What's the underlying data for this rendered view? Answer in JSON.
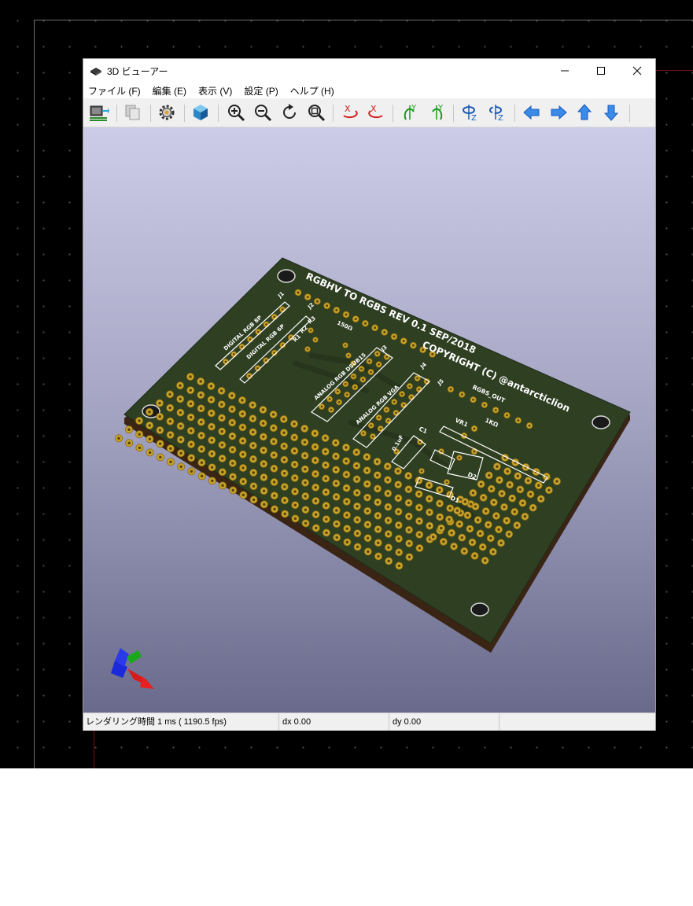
{
  "window": {
    "title": "3D ビューアー",
    "controls": {
      "minimize": "—",
      "maximize": "☐",
      "close": "✕"
    }
  },
  "menu": [
    {
      "label": "ファイル (F)"
    },
    {
      "label": "編集 (E)"
    },
    {
      "label": "表示 (V)"
    },
    {
      "label": "設定 (P)"
    },
    {
      "label": "ヘルプ (H)"
    }
  ],
  "toolbar": {
    "icons": [
      "reload-board-icon",
      "copy-image-icon",
      "settings-gear-icon",
      "toggle-3d-view-icon",
      "zoom-in-icon",
      "zoom-out-icon",
      "redraw-icon",
      "zoom-fit-icon",
      "rotate-x-cw-icon",
      "rotate-x-ccw-icon",
      "rotate-y-cw-icon",
      "rotate-y-ccw-icon",
      "rotate-z-cw-icon",
      "rotate-z-ccw-icon",
      "move-left-icon",
      "move-right-icon",
      "move-up-icon",
      "move-down-icon"
    ],
    "axis_labels": {
      "x": "X",
      "y": "Y",
      "z": "Z"
    }
  },
  "pcb": {
    "title": "RGBHV TO RGBS REV 0.1   SEP/2018",
    "copyright": "COPYRIGHT (C) @antarcticlion",
    "labels": {
      "digital_rgb_8p": "DIGITAL RGB 8P",
      "digital_rgb_6p": "DIGITAL RGB 6P",
      "analog_dsub": "ANALOG RGB DSUB15",
      "analog_vga": "ANALOG RGB VGA",
      "rgbs_out": "RGBS_OUT",
      "resistor_value": "150Ω",
      "pot_value": "1KΩ",
      "cap_value": "0.1uF",
      "j1": "J1",
      "j2": "J2",
      "j3": "J3",
      "j4": "J4",
      "j5": "J5",
      "r1": "R1",
      "r2": "R2",
      "r3": "R3",
      "vr1": "VR1",
      "c1": "C1",
      "d1": "D1",
      "d2": "D2"
    }
  },
  "status": {
    "render_time": "レンダリング時間 1 ms ( 1190.5 fps)",
    "dx": "dx 0.00",
    "dy": "dy 0.00"
  },
  "colors": {
    "canvas_bg": "#000000",
    "board_green": "#2e3f22",
    "pad_gold": "#c8a42a",
    "silkscreen": "#ffffff",
    "viewport_top": "#cccce8",
    "viewport_bottom": "#6a6a8c"
  }
}
